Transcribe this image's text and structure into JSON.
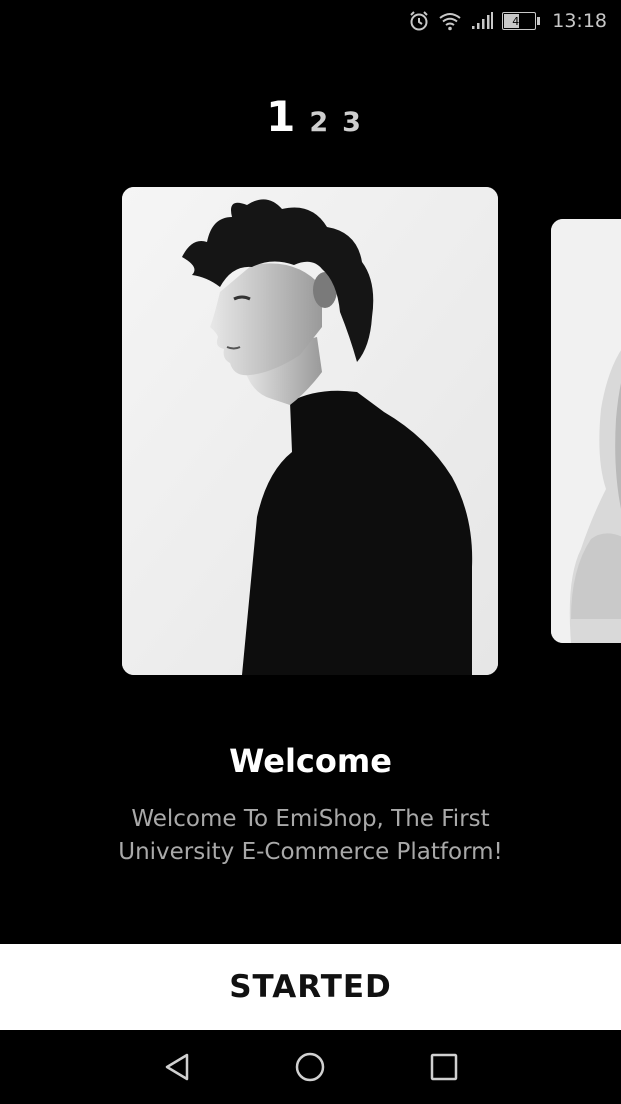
{
  "status_bar": {
    "icons": [
      "alarm-icon",
      "wifi-icon",
      "signal-icon",
      "battery-icon"
    ],
    "battery_level": "48",
    "time": "13:18"
  },
  "pager": {
    "pages": [
      "1",
      "2",
      "3"
    ],
    "active_index": 0
  },
  "cards": [
    {
      "image": "man-in-black-turtleneck-portrait"
    },
    {
      "image": "blonde-woman-portrait-partial"
    }
  ],
  "onboarding": {
    "title": "Welcome",
    "description": "Welcome To EmiShop, The First University E-Commerce Platform!"
  },
  "button": {
    "label": "STARTED"
  },
  "nav_bar": {
    "items": [
      "back-icon",
      "home-icon",
      "recents-icon"
    ]
  },
  "colors": {
    "background": "#000000",
    "button_bg": "#ffffff",
    "subtitle": "#a9a9a9"
  }
}
